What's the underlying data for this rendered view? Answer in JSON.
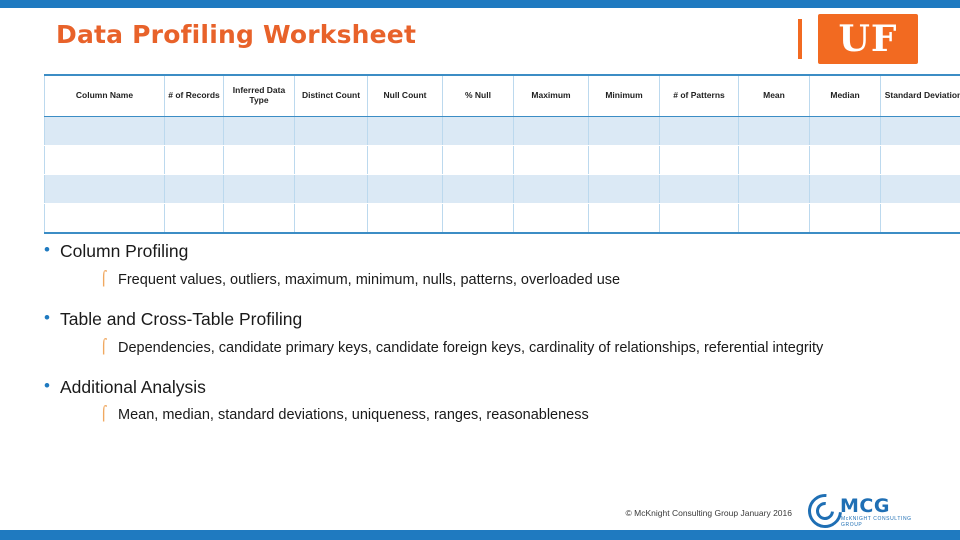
{
  "slide": {
    "title": "Data Profiling Worksheet",
    "accent_blue": "#1f7ac0",
    "accent_orange": "#e8622a"
  },
  "branding": {
    "uf_text": "UF",
    "mcg_name": "MCG",
    "mcg_sub": "McKNIGHT CONSULTING GROUP"
  },
  "table": {
    "headers": [
      "Column Name",
      "# of Records",
      "Inferred Data Type",
      "Distinct Count",
      "Null Count",
      "% Null",
      "Maximum",
      "Minimum",
      "# of Patterns",
      "Mean",
      "Median",
      "Standard Deviation"
    ],
    "rows": [
      [
        "",
        "",
        "",
        "",
        "",
        "",
        "",
        "",
        "",
        "",
        "",
        ""
      ],
      [
        "",
        "",
        "",
        "",
        "",
        "",
        "",
        "",
        "",
        "",
        "",
        ""
      ],
      [
        "",
        "",
        "",
        "",
        "",
        "",
        "",
        "",
        "",
        "",
        "",
        ""
      ],
      [
        "",
        "",
        "",
        "",
        "",
        "",
        "",
        "",
        "",
        "",
        "",
        ""
      ]
    ]
  },
  "bullets": [
    {
      "level1": "Column Profiling",
      "level2": "Frequent values, outliers, maximum, minimum, nulls, patterns, overloaded use"
    },
    {
      "level1": "Table and Cross-Table Profiling",
      "level2": "Dependencies, candidate primary keys, candidate foreign keys, cardinality of relationships, referential integrity"
    },
    {
      "level1": "Additional Analysis",
      "level2": "Mean, median, standard deviations, uniqueness, ranges, reasonableness"
    }
  ],
  "bullet_glyphs": {
    "level1": "•",
    "level2": "⌠"
  },
  "footer": {
    "copyright": "© McKnight Consulting Group January 2016"
  }
}
